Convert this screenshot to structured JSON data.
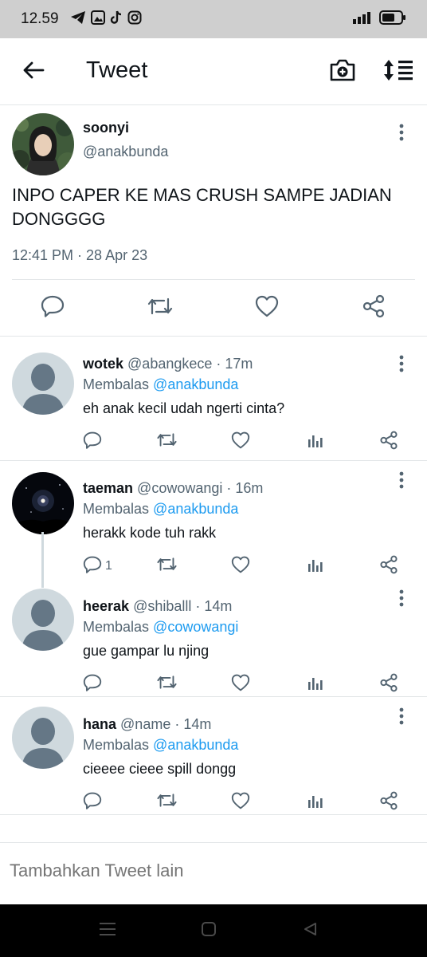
{
  "status_bar": {
    "time": "12.59",
    "icons": [
      "telegram-icon",
      "gallery-icon",
      "tiktok-icon",
      "instagram-icon"
    ],
    "signal": "signal-icon",
    "battery": "battery-icon"
  },
  "header": {
    "title": "Tweet",
    "back_icon": "arrow-left-icon",
    "camera_icon": "camera-plus-icon",
    "sort_icon": "sort-icon"
  },
  "main_tweet": {
    "name": "soonyi",
    "handle": "@anakbunda",
    "text": "INPO CAPER KE MAS CRUSH SAMPE JADIAN DONGGGG",
    "timestamp": "12:41 PM · 28 Apr 23"
  },
  "replies": [
    {
      "name": "wotek",
      "handle": "@abangkece",
      "time": "· 17m",
      "replying_prefix": "Membalas",
      "replying_to": "@anakbunda",
      "text": "eh anak kecil udah ngerti cinta?",
      "reply_count": ""
    },
    {
      "name": "taeman",
      "handle": "@cowowangi",
      "time": "· 16m",
      "replying_prefix": "Membalas",
      "replying_to": "@anakbunda",
      "text": "herakk kode tuh rakk",
      "reply_count": "1"
    },
    {
      "name": "heerak",
      "handle": "@shiballl",
      "time": "· 14m",
      "replying_prefix": "Membalas",
      "replying_to": "@cowowangi",
      "text": "gue gampar lu njing",
      "reply_count": ""
    },
    {
      "name": "hana",
      "handle": "@name",
      "time": "· 14m",
      "replying_prefix": "Membalas",
      "replying_to": "@anakbunda",
      "text": "cieeee cieee spill dongg",
      "reply_count": ""
    }
  ],
  "compose": {
    "placeholder": "Tambahkan Tweet lain"
  },
  "colors": {
    "accent": "#1d9bf0",
    "secondary_text": "#536471",
    "status_bar": "#cfcfcf",
    "nav_bar": "#000000"
  }
}
